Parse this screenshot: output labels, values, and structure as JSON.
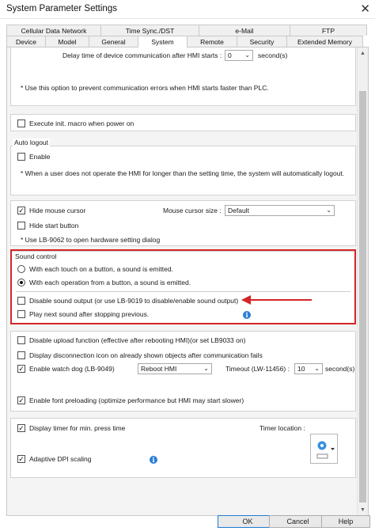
{
  "window": {
    "title": "System Parameter Settings",
    "close_glyph": "✕"
  },
  "tabs_row1": [
    "Cellular Data Network",
    "Time Sync./DST",
    "e-Mail",
    "FTP"
  ],
  "tabs_row2": [
    "Device",
    "Model",
    "General",
    "System",
    "Remote",
    "Security",
    "Extended Memory"
  ],
  "active_tab": "System",
  "comm_delay": {
    "label": "Delay time of device communication after HMI starts :",
    "value": "0",
    "unit": "second(s)",
    "note": "* Use this option to prevent communication errors when HMI starts faster than PLC."
  },
  "init_macro": {
    "label": "Execute init. macro when power on",
    "checked": false
  },
  "auto_logout": {
    "title": "Auto logout",
    "enable_label": "Enable",
    "enable_checked": false,
    "note": "* When a user does not operate the HMI for longer than the setting time, the system will automatically logout."
  },
  "cursor": {
    "hide_mouse_label": "Hide mouse cursor",
    "hide_mouse_checked": true,
    "size_label": "Mouse cursor size :",
    "size_value": "Default",
    "hide_start_label": "Hide start button",
    "hide_start_checked": false,
    "note": "* Use LB-9062 to open hardware setting dialog"
  },
  "sound": {
    "title": "Sound control",
    "radio1": "With each touch on a button, a sound is emitted.",
    "radio2": "With each operation from a button, a sound is emitted.",
    "selected": 2,
    "disable_label": "Disable sound output (or use LB-9019 to disable/enable sound output)",
    "disable_checked": false,
    "play_next_label": "Play next sound after stopping previous.",
    "play_next_checked": false
  },
  "misc": {
    "disable_upload_label": "Disable upload function (effective after rebooting HMI)(or set LB9033 on)",
    "disable_upload_checked": false,
    "display_disconnect_label": "Display disconnection icon on already shown objects after communication fails",
    "display_disconnect_checked": false,
    "watchdog_label": "Enable watch dog (LB-9049)",
    "watchdog_checked": true,
    "watchdog_action": "Reboot HMI",
    "timeout_label": "Timeout (LW-11456) :",
    "timeout_value": "10",
    "timeout_unit": "second(s)",
    "font_preload_label": "Enable font preloading (optimize performance but HMI may start slower)",
    "font_preload_checked": true
  },
  "timer": {
    "display_timer_label": "Display timer for min. press time",
    "display_timer_checked": true,
    "location_label": "Timer location :",
    "adaptive_dpi_label": "Adaptive DPI scaling",
    "adaptive_dpi_checked": true
  },
  "buttons": {
    "ok": "OK",
    "cancel": "Cancel",
    "help": "Help"
  },
  "glyphs": {
    "check": "✓",
    "info": "i",
    "arrow_down": "⌄",
    "scroll_up": "▲",
    "scroll_down": "▼"
  },
  "colors": {
    "highlight": "#d42525",
    "info": "#2a7fd4",
    "scroll_thumb": "#c2c2c2"
  }
}
